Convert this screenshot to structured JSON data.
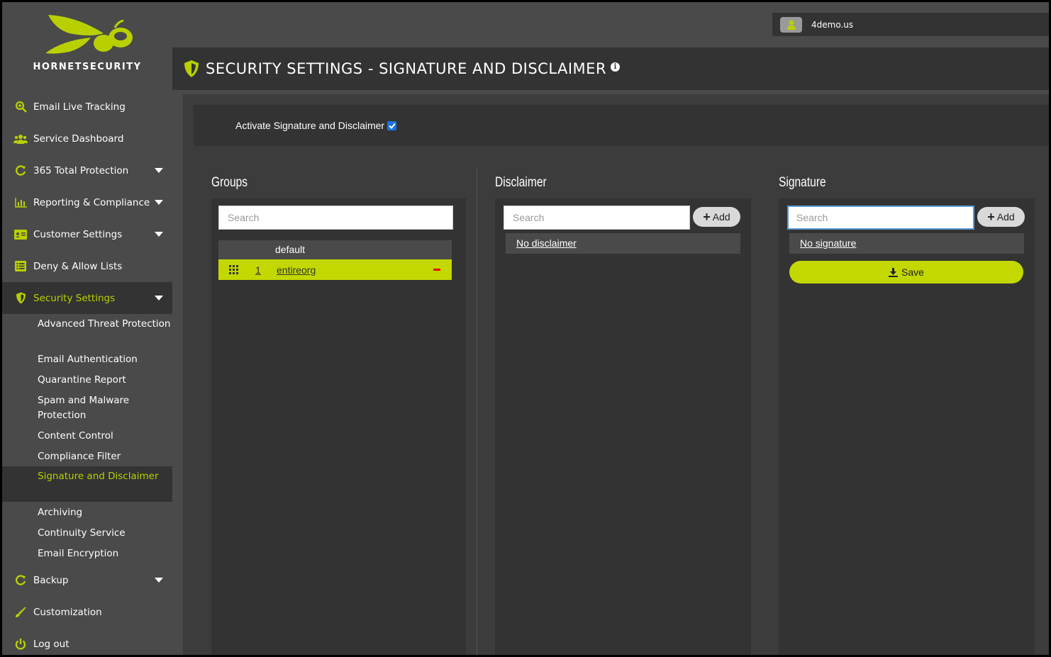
{
  "brand": {
    "name": "HORNETSECURITY",
    "accent_color": "#b9d000"
  },
  "user": {
    "domain": "4demo.us",
    "icon": "user-icon"
  },
  "page": {
    "title": "SECURITY SETTINGS - SIGNATURE AND DISCLAIMER",
    "title_icon": "shield-icon",
    "info_icon": "info-icon"
  },
  "sidebar": {
    "items": [
      {
        "label": "Email Live Tracking",
        "icon": "search-plus-icon",
        "has_submenu": false
      },
      {
        "label": "Service Dashboard",
        "icon": "users-icon",
        "has_submenu": false
      },
      {
        "label": "365 Total Protection",
        "icon": "refresh-icon",
        "has_submenu": true
      },
      {
        "label": "Reporting & Compliance",
        "icon": "bar-chart-icon",
        "has_submenu": true
      },
      {
        "label": "Customer Settings",
        "icon": "id-card-icon",
        "has_submenu": true
      },
      {
        "label": "Deny & Allow Lists",
        "icon": "list-icon",
        "has_submenu": false
      },
      {
        "label": "Security Settings",
        "icon": "shield-icon",
        "has_submenu": true,
        "active": true
      },
      {
        "label": "Backup",
        "icon": "refresh-icon",
        "has_submenu": true
      },
      {
        "label": "Customization",
        "icon": "brush-icon",
        "has_submenu": false
      },
      {
        "label": "Log out",
        "icon": "power-icon",
        "has_submenu": false
      }
    ],
    "security_subitems": [
      {
        "label": "Advanced Threat Protection"
      },
      {
        "label": "Email Authentication"
      },
      {
        "label": "Quarantine Report"
      },
      {
        "label": "Spam and Malware Protection"
      },
      {
        "label": "Content Control"
      },
      {
        "label": "Compliance Filter"
      },
      {
        "label": "Signature and Disclaimer",
        "active": true
      },
      {
        "label": "Archiving"
      },
      {
        "label": "Continuity Service"
      },
      {
        "label": "Email Encryption"
      }
    ]
  },
  "activate": {
    "label": "Activate Signature and Disclaimer",
    "checked": true
  },
  "groups": {
    "title": "Groups",
    "search_placeholder": "Search",
    "header": "default",
    "rows": [
      {
        "number": "1",
        "name": "entireorg"
      }
    ]
  },
  "disclaimer": {
    "title": "Disclaimer",
    "search_placeholder": "Search",
    "add_label": "Add",
    "none_label": "No disclaimer"
  },
  "signature": {
    "title": "Signature",
    "search_placeholder": "Search",
    "add_label": "Add",
    "none_label": "No signature",
    "save_label": "Save"
  }
}
